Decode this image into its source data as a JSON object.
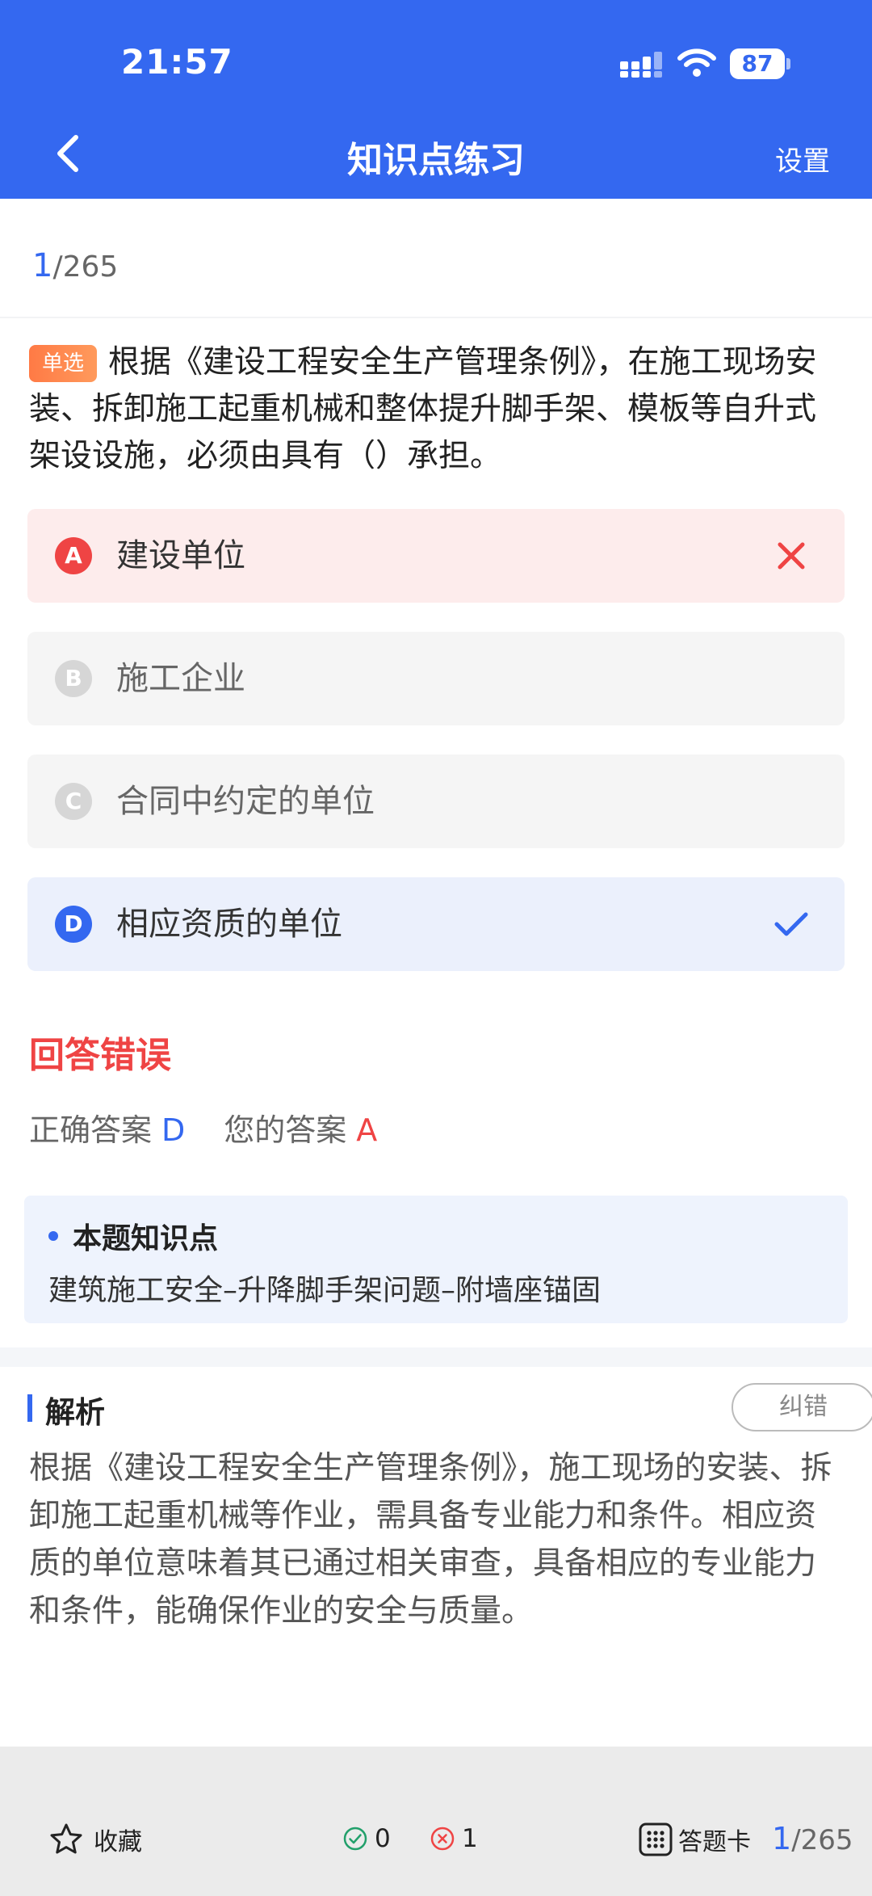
{
  "status_bar": {
    "time": "21:57",
    "battery": "87"
  },
  "header": {
    "title": "知识点练习",
    "settings_label": "设置"
  },
  "progress": {
    "current": "1",
    "total": "/265"
  },
  "question": {
    "type_tag": "单选",
    "text": "根据《建设工程安全生产管理条例》，在施工现场安装、拆卸施工起重机械和整体提升脚手架、模板等自升式架设设施，必须由具有（）承担。"
  },
  "options": [
    {
      "letter": "A",
      "text": "建设单位",
      "state": "wrong"
    },
    {
      "letter": "B",
      "text": "施工企业",
      "state": "neutral"
    },
    {
      "letter": "C",
      "text": "合同中约定的单位",
      "state": "neutral"
    },
    {
      "letter": "D",
      "text": "相应资质的单位",
      "state": "correct"
    }
  ],
  "result": {
    "title": "回答错误",
    "correct_label": "正确答案",
    "correct_value": "D",
    "yours_label": "您的答案",
    "yours_value": "A"
  },
  "knowledge_point": {
    "title": "本题知识点",
    "text": "建筑施工安全–升降脚手架问题–附墙座锚固"
  },
  "analysis": {
    "title": "解析",
    "correction_label": "纠错",
    "text": "根据《建设工程安全生产管理条例》，施工现场的安装、拆卸施工起重机械等作业，需具备专业能力和条件。相应资质的单位意味着其已通过相关审查，具备相应的专业能力和条件，能确保作业的安全与质量。"
  },
  "bottom_bar": {
    "favorite_label": "收藏",
    "correct_count": "0",
    "wrong_count": "1",
    "answer_card_label": "答题卡",
    "progress_current": "1",
    "progress_total": "/265"
  },
  "colors": {
    "primary": "#3468F0",
    "error": "#EF4444",
    "tag": "#FF7A45"
  },
  "icons": [
    "back-chevron-icon",
    "signal-icon",
    "wifi-icon",
    "battery-icon",
    "cross-icon",
    "check-icon",
    "star-icon",
    "check-circle-icon",
    "cross-circle-icon",
    "grid-icon"
  ]
}
